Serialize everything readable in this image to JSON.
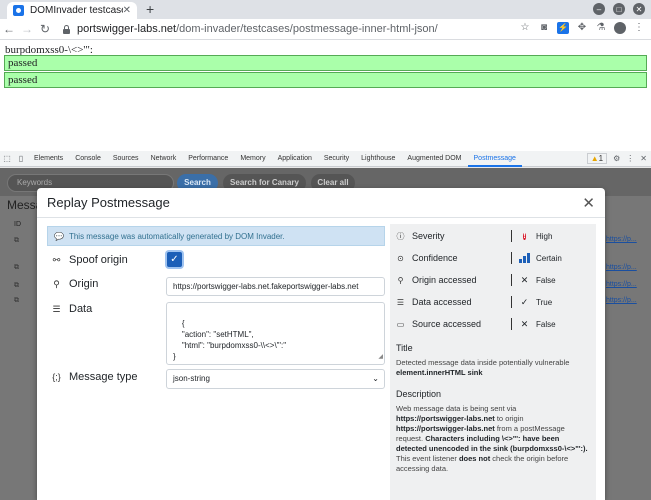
{
  "browser": {
    "tab_title": "DOMInvader testcases",
    "url_host": "portswigger-labs.net",
    "url_path": "/dom-invader/testcases/postmessage-inner-html-json/"
  },
  "page": {
    "heading": "burpdomxss0-\\<>'\":",
    "results": [
      "passed",
      "passed"
    ]
  },
  "devtools": {
    "tabs": [
      "Elements",
      "Console",
      "Sources",
      "Network",
      "Performance",
      "Memory",
      "Application",
      "Security",
      "Lighthouse",
      "Augmented DOM",
      "Postmessage"
    ],
    "active_tab": "Postmessage",
    "warning_count": "1",
    "keywords_placeholder": "Keywords",
    "search_label": "Search",
    "search_canary_label": "Search for Canary",
    "clear_all_label": "Clear all",
    "bg_title": "Messa",
    "bg_id_header": "ID",
    "bg_link_text": "https://p..."
  },
  "modal": {
    "title": "Replay Postmessage",
    "info": "This message was automatically generated by DOM Invader.",
    "spoof_origin_label": "Spoof origin",
    "spoof_origin_checked": true,
    "origin_label": "Origin",
    "origin_value": "https://portswigger-labs.net.fakeportswigger-labs.net",
    "data_label": "Data",
    "data_value": "{\n    \"action\": \"setHTML\",\n    \"html\": \"burpdomxss0-\\\\<>\\\"':\"\n}",
    "message_type_label": "Message type",
    "message_type_value": "json-string",
    "properties": [
      {
        "name": "Severity",
        "value": "High"
      },
      {
        "name": "Confidence",
        "value": "Certain"
      },
      {
        "name": "Origin accessed",
        "value": "False"
      },
      {
        "name": "Data accessed",
        "value": "True"
      },
      {
        "name": "Source accessed",
        "value": "False"
      }
    ],
    "title_heading": "Title",
    "title_text": "Detected message data inside potentially vulnerable",
    "title_sink": "element.innerHTML sink",
    "description_heading": "Description",
    "desc_1": "Web message data is being sent via",
    "desc_2": "https://portswigger-labs.net",
    "desc_3": " to origin",
    "desc_4": "https://portswigger-labs.net",
    "desc_5": " from a postMessage request. ",
    "desc_6": "Characters including \\<>\"': have been detected unencoded in the sink (burpdomxss0-\\<>\"':).",
    "desc_7": " This event listener ",
    "desc_8": "does not",
    "desc_9": " check the origin before accessing data."
  },
  "colors": {
    "checkbox": "#1c5fb8",
    "severity_high": "#d81b2c",
    "pass_bg": "#aaffaa",
    "info_bg": "#cfe2f3",
    "dom_button": "#3b6fa8"
  }
}
